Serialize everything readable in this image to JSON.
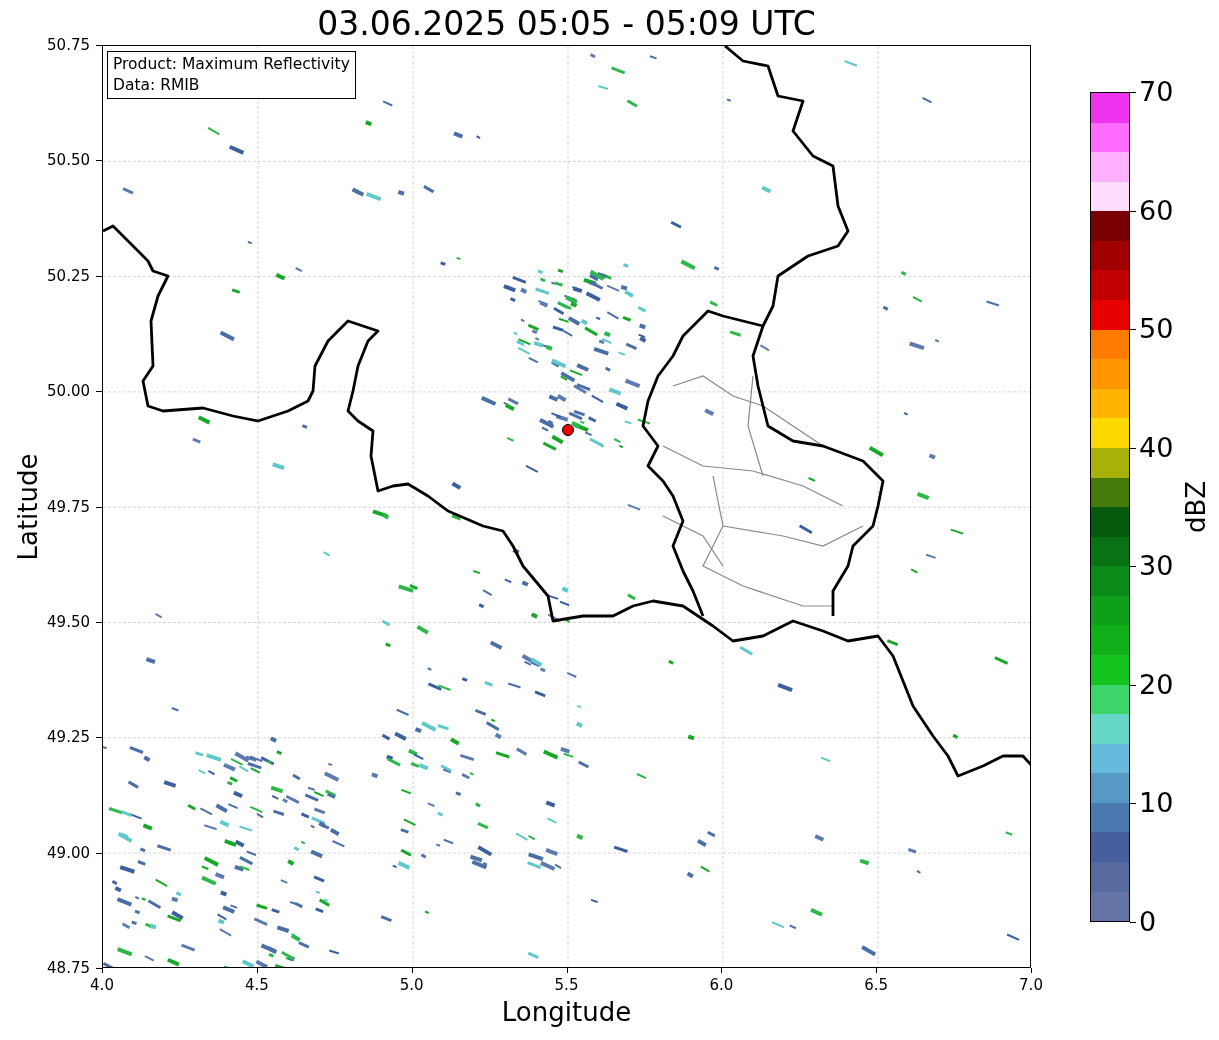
{
  "title": "03.06.2025 05:05 - 05:09 UTC",
  "map": {
    "xlabel": "Longitude",
    "ylabel": "Latitude",
    "xticks": [
      "4.0",
      "4.5",
      "5.0",
      "5.5",
      "6.0",
      "6.5",
      "7.0"
    ],
    "yticks": [
      "50.75",
      "50.50",
      "50.25",
      "50.00",
      "49.75",
      "49.50",
      "49.25",
      "49.00",
      "48.75"
    ],
    "legend": [
      "Product: Maximum Reflectivity",
      "Data: RMIB"
    ]
  },
  "colorbar": {
    "label": "dBZ",
    "ticks": [
      "70",
      "60",
      "50",
      "40",
      "30",
      "20",
      "10",
      "0"
    ],
    "bins": [
      {
        "color": "#ee33ee"
      },
      {
        "color": "#ff6cff"
      },
      {
        "color": "#ffb0ff"
      },
      {
        "color": "#ffddff"
      },
      {
        "color": "#780000"
      },
      {
        "color": "#a00000"
      },
      {
        "color": "#c00000"
      },
      {
        "color": "#e60000"
      },
      {
        "color": "#ff7c00"
      },
      {
        "color": "#ff9800"
      },
      {
        "color": "#ffb400"
      },
      {
        "color": "#ffd800"
      },
      {
        "color": "#aab00a"
      },
      {
        "color": "#457a0a"
      },
      {
        "color": "#055a0e"
      },
      {
        "color": "#087214"
      },
      {
        "color": "#0a8a18"
      },
      {
        "color": "#0ea01a"
      },
      {
        "color": "#11b01b"
      },
      {
        "color": "#14c41e"
      },
      {
        "color": "#3dd46a"
      },
      {
        "color": "#66d8c8"
      },
      {
        "color": "#66bbdd"
      },
      {
        "color": "#5599c4"
      },
      {
        "color": "#4a7ab0"
      },
      {
        "color": "#46609e"
      },
      {
        "color": "#566aa0"
      },
      {
        "color": "#6474a6"
      }
    ]
  }
}
